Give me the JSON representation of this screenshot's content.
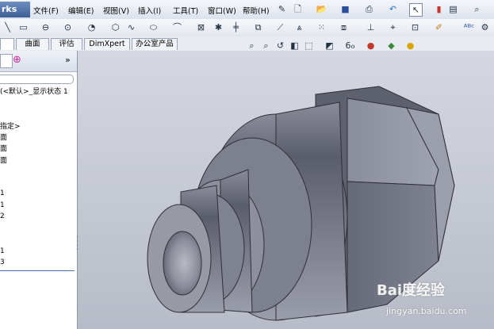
{
  "app": {
    "logo_text": "rks"
  },
  "menu": {
    "items": [
      "文件(F)",
      "编辑(E)",
      "视图(V)",
      "插入(I)",
      "工具(T)",
      "窗口(W)",
      "帮助(H)"
    ]
  },
  "tabs": [
    "曲面",
    "评估",
    "DimXpert",
    "办公室产品"
  ],
  "left_panel": {
    "expand_glyph": "»",
    "tree": [
      "(<默认>_显示状态 1",
      "指定>",
      "面",
      "面",
      "面",
      "1",
      "1",
      "2",
      "1",
      "3"
    ]
  },
  "watermark": {
    "logo": "Bai度经验",
    "url": "jingyan.baidu.com"
  },
  "colors": {
    "viewport_top": "#d4d7df",
    "viewport_bottom": "#b8bcc8",
    "part_metal": "#6f7280",
    "menubar": "#e6eaf1"
  },
  "icons": [
    "sketch-line-icon",
    "rectangle-icon",
    "slot-icon",
    "circle-icon",
    "arc-icon",
    "polygon-icon",
    "spline-icon",
    "ellipse-icon",
    "new-document-icon",
    "open-icon",
    "save-icon",
    "print-icon",
    "undo-icon",
    "select-icon",
    "rebuild-icon",
    "options-icon",
    "zoom-icon",
    "view-orientation-icon",
    "display-style-icon",
    "appearance-icon"
  ]
}
